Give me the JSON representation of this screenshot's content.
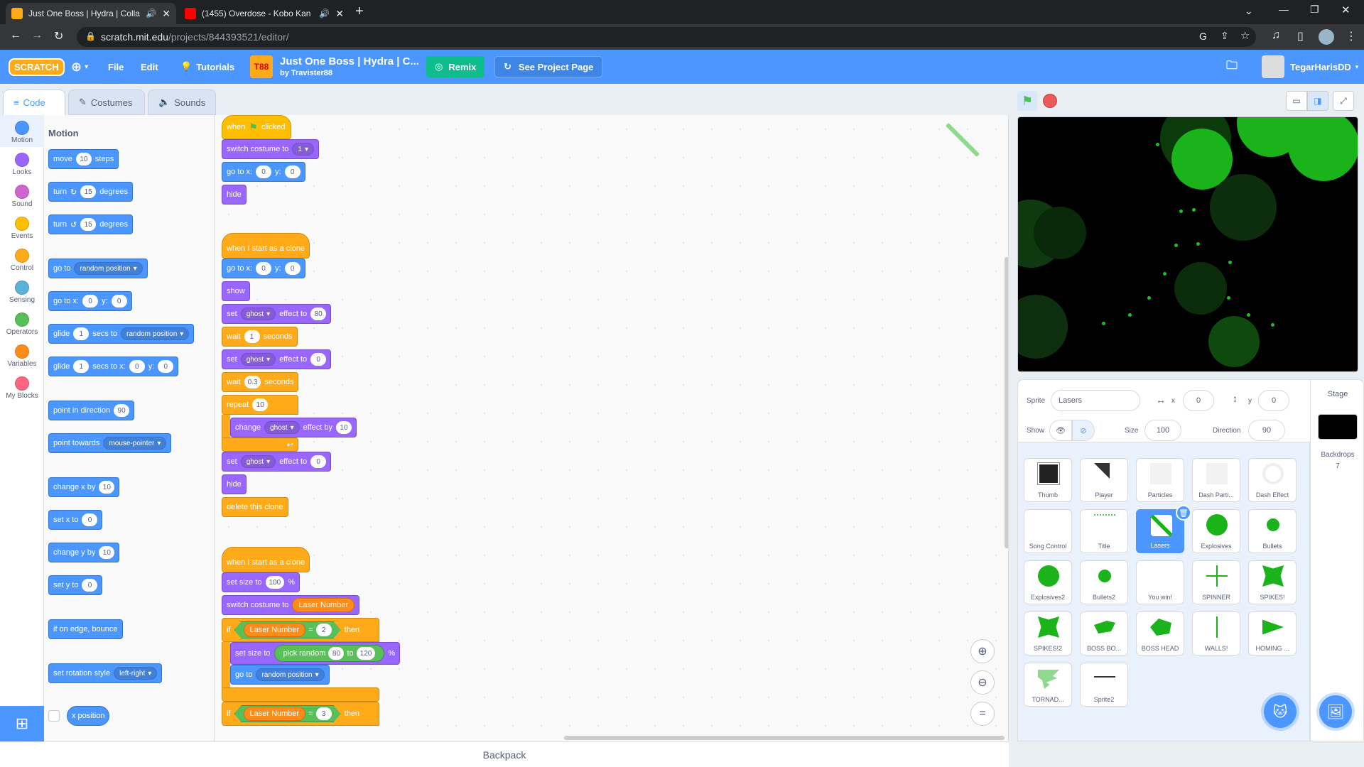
{
  "browser": {
    "tabs": [
      {
        "title": "Just One Boss | Hydra | Collal",
        "active": true
      },
      {
        "title": "(1455) Overdose - Kobo Kan",
        "active": false
      }
    ],
    "new_tab": "+",
    "url_host": "scratch.mit.edu",
    "url_path": "/projects/844393521/editor/"
  },
  "menubar": {
    "logo": "SCRATCH",
    "language_icon": "globe-icon",
    "file": "File",
    "edit": "Edit",
    "tutorials": "Tutorials",
    "project_thumb": "T88",
    "project_title": "Just One Boss | Hydra | C...",
    "project_author": "by Travister88",
    "remix": "Remix",
    "see_project_page": "See Project Page",
    "username": "TegarHarisDD"
  },
  "editor_tabs": [
    "Code",
    "Costumes",
    "Sounds"
  ],
  "categories": [
    {
      "label": "Motion",
      "color": "#4c97ff"
    },
    {
      "label": "Looks",
      "color": "#9966ff"
    },
    {
      "label": "Sound",
      "color": "#cf63cf"
    },
    {
      "label": "Events",
      "color": "#ffbf00"
    },
    {
      "label": "Control",
      "color": "#ffab19"
    },
    {
      "label": "Sensing",
      "color": "#5cb1d6"
    },
    {
      "label": "Operators",
      "color": "#59c059"
    },
    {
      "label": "Variables",
      "color": "#ff8c1a"
    },
    {
      "label": "My Blocks",
      "color": "#ff6680"
    }
  ],
  "palette": {
    "heading": "Motion",
    "move": {
      "a": "move",
      "v": "10",
      "b": "steps"
    },
    "turn_right": {
      "a": "turn",
      "v": "15",
      "b": "degrees"
    },
    "turn_left": {
      "a": "turn",
      "v": "15",
      "b": "degrees"
    },
    "goto": {
      "a": "go to",
      "dd": "random position"
    },
    "gotoxy": {
      "a": "go to x:",
      "x": "0",
      "b": "y:",
      "y": "0"
    },
    "glide": {
      "a": "glide",
      "v": "1",
      "b": "secs to",
      "dd": "random position"
    },
    "glidexy": {
      "a": "glide",
      "v": "1",
      "b": "secs to x:",
      "x": "0",
      "c": "y:",
      "y": "0"
    },
    "point_dir": {
      "a": "point in direction",
      "v": "90"
    },
    "point_towards": {
      "a": "point towards",
      "dd": "mouse-pointer"
    },
    "change_x": {
      "a": "change x by",
      "v": "10"
    },
    "set_x": {
      "a": "set x to",
      "v": "0"
    },
    "change_y": {
      "a": "change y by",
      "v": "10"
    },
    "set_y": {
      "a": "set y to",
      "v": "0"
    },
    "bounce": "if on edge, bounce",
    "rotation": {
      "a": "set rotation style",
      "dd": "left-right"
    },
    "x_position": "x position"
  },
  "script1": {
    "when": "when",
    "clicked": "clicked",
    "switch_costume": "switch costume to",
    "costume": "1",
    "goto": "go to x:",
    "x": "0",
    "y_lbl": "y:",
    "y": "0",
    "hide": "hide"
  },
  "script2": {
    "hat": "when I start as a clone",
    "goto": "go to x:",
    "x": "0",
    "y_lbl": "y:",
    "y": "0",
    "show": "show",
    "set": "set",
    "ghost": "ghost",
    "effect_to": "effect to",
    "v80": "80",
    "wait": "wait",
    "w1": "1",
    "seconds": "seconds",
    "v0": "0",
    "w03": "0.3",
    "repeat": "repeat",
    "r10": "10",
    "change": "change",
    "effect_by": "effect by",
    "c10": "10",
    "delete": "delete this clone"
  },
  "script3": {
    "hat": "when I start as a clone",
    "set_size": "set size to",
    "size": "100",
    "pct": "%",
    "switch_costume": "switch costume to",
    "laser_number": "Laser Number",
    "if": "if",
    "eq": "=",
    "two": "2",
    "then": "then",
    "pick_random": "pick random",
    "r80": "80",
    "to": "to",
    "r120": "120",
    "goto": "go to",
    "random_position": "random position",
    "three": "3"
  },
  "backpack": "Backpack",
  "sprite_info": {
    "sprite_label": "Sprite",
    "sprite_name": "Lasers",
    "x_label": "x",
    "x": "0",
    "y_label": "y",
    "y": "0",
    "show_label": "Show",
    "size_label": "Size",
    "size": "100",
    "direction_label": "Direction",
    "direction": "90"
  },
  "sprites": [
    "Thumb",
    "Player",
    "Particles",
    "Dash Parti...",
    "Dash Effect",
    "Song Control",
    "Title",
    "Lasers",
    "Explosives",
    "Bullets",
    "Explosives2",
    "Bullets2",
    "You win!",
    "SPINNER",
    "SPIKES!",
    "SPIKES!2",
    "BOSS BO...",
    "BOSS HEAD",
    "WALLS!",
    "HOMING ...",
    "TORNAD...",
    "Sprite2"
  ],
  "selected_sprite": "Lasers",
  "stage_panel": {
    "label": "Stage",
    "backdrops_label": "Backdrops",
    "backdrops": "7"
  }
}
